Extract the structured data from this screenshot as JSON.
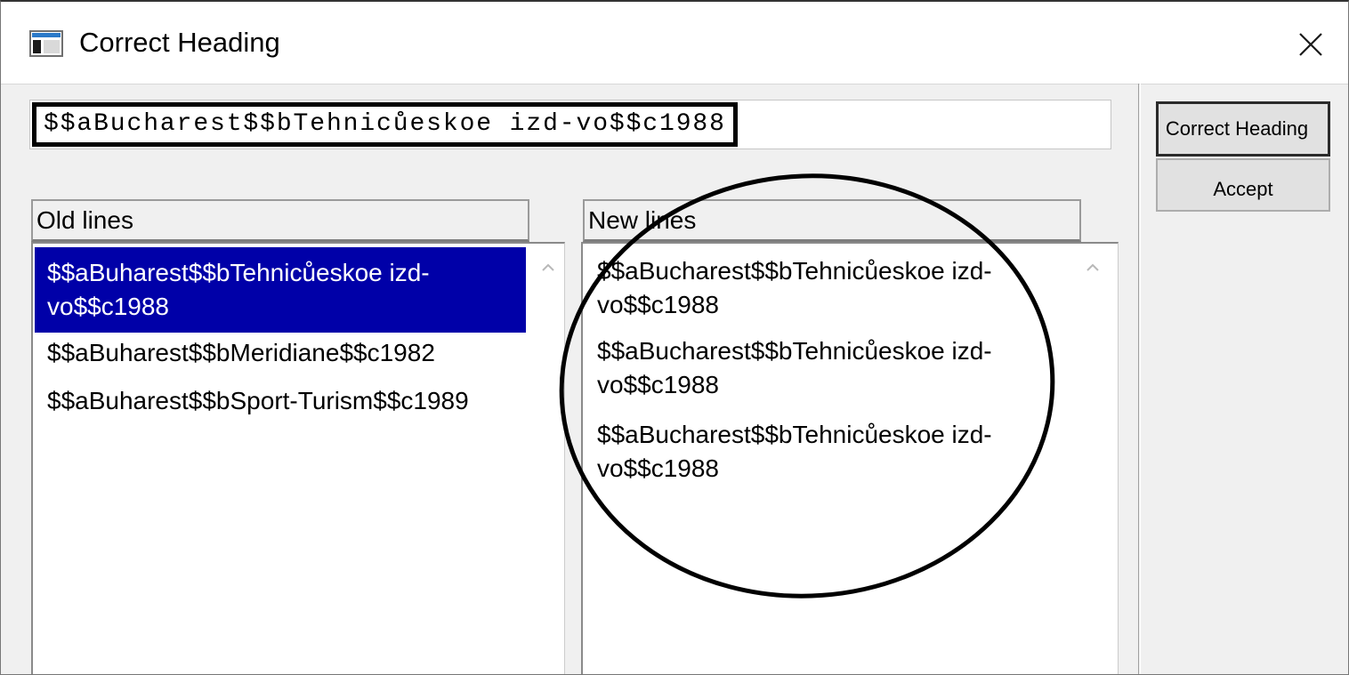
{
  "window": {
    "title": "Correct Heading"
  },
  "heading_field": {
    "value": "$$aBucharest$$bTehnicůeskoe izd-vo$$c1988"
  },
  "buttons": {
    "correct_heading": "Correct Heading",
    "accept": "Accept"
  },
  "old_lines": {
    "header": "Old lines",
    "items": [
      {
        "text": "$$aBuharest$$bTehnicůeskoe izd-vo$$c1988",
        "selected": true
      },
      {
        "text": "$$aBuharest$$bMeridiane$$c1982",
        "selected": false
      },
      {
        "text": "$$aBuharest$$bSport-Turism$$c1989",
        "selected": false
      }
    ]
  },
  "new_lines": {
    "header": "New lines",
    "items": [
      {
        "text": "$$aBucharest$$bTehnicůeskoe izd-vo$$c1988"
      },
      {
        "text": "$$aBucharest$$bTehnicůeskoe izd-vo$$c1988"
      },
      {
        "text": "$$aBucharest$$bTehnicůeskoe izd-vo$$c1988"
      }
    ]
  },
  "icons": {
    "app": "window-app-icon",
    "close": "close-icon",
    "scroll": "scroll-up-arrow-icon"
  },
  "colors": {
    "selection_bg": "#0000a8",
    "selection_fg": "#ffffff",
    "annotation": "#000000"
  }
}
